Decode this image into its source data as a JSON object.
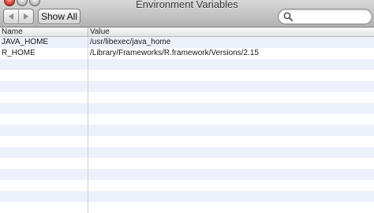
{
  "window": {
    "title": "Environment Variables"
  },
  "toolbar": {
    "back_icon": "chevron-left-icon",
    "forward_icon": "chevron-right-icon",
    "show_all_label": "Show All",
    "search": {
      "placeholder": "",
      "value": "",
      "icon": "search-icon"
    }
  },
  "table": {
    "columns": [
      "Name",
      "Value"
    ],
    "rows": [
      {
        "name": "JAVA_HOME",
        "value": "/usr/libexec/java_home"
      },
      {
        "name": "R_HOME",
        "value": "/Library/Frameworks/R.framework/Versions/2.15"
      }
    ]
  },
  "colors": {
    "row_stripe": "#ecf1fb",
    "toolbar_top": "#d9d9d9",
    "toolbar_bottom": "#b2b2b2"
  }
}
